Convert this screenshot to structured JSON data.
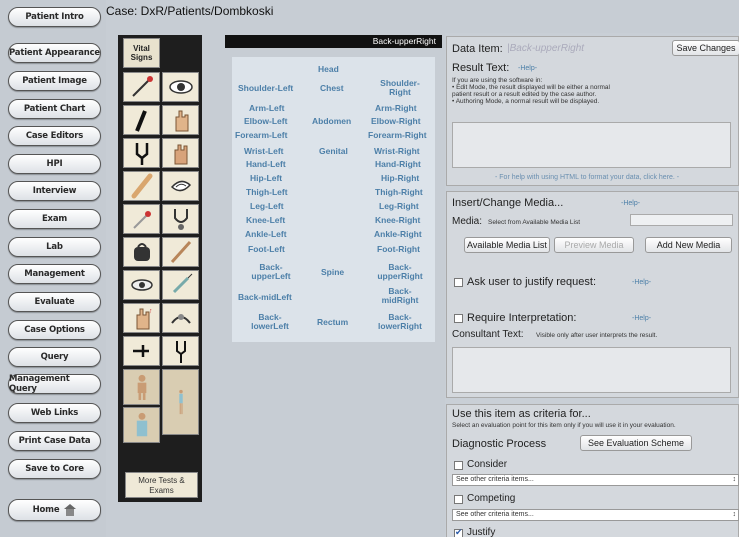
{
  "case_title": "Case: DxR/Patients/Dombkoski",
  "nav": [
    "Patient Intro",
    "Patient Appearance",
    "Patient Image",
    "Patient Chart",
    "Case Editors",
    "HPI",
    "Interview",
    "Exam",
    "Lab",
    "Management",
    "Evaluate",
    "Case Options",
    "Query",
    "Management Query",
    "Web Links",
    "Print Case Data",
    "Save to Core",
    "Home"
  ],
  "palette": {
    "vital_signs": "Vital Signs",
    "more_label": "More Tests & Exams",
    "tools": [
      "reflex-hammer-icon",
      "eye-icon",
      "flashlight-icon",
      "palpate-hand-icon",
      "tuning-fork-icon",
      "hand-icon",
      "otoscope-icon",
      "ear-icon",
      "swab-icon",
      "stethoscope-icon",
      "bp-cuff-icon",
      "tongue-depressor-icon",
      "ophthalmoscope-icon",
      "syringe-icon",
      "hand-up-icon",
      "percussion-icon",
      "thermometer-icon",
      "tuning-fork-2-icon",
      "female-front-icon",
      "female-side-icon",
      "female-torso-icon"
    ]
  },
  "bodymap": {
    "header": "Back-upperRight",
    "parts": {
      "head": "Head",
      "shoulder_left": "Shoulder-Left",
      "chest": "Chest",
      "shoulder_right": "Shoulder-Right",
      "arm_left": "Arm-Left",
      "arm_right": "Arm-Right",
      "elbow_left": "Elbow-Left",
      "abdomen": "Abdomen",
      "elbow_right": "Elbow-Right",
      "forearm_left": "Forearm-Left",
      "forearm_right": "Forearm-Right",
      "wrist_left": "Wrist-Left",
      "genital": "Genital",
      "wrist_right": "Wrist-Right",
      "hand_left": "Hand-Left",
      "hand_right": "Hand-Right",
      "hip_left": "Hip-Left",
      "hip_right": "Hip-Right",
      "thigh_left": "Thigh-Left",
      "thigh_right": "Thigh-Right",
      "leg_left": "Leg-Left",
      "leg_right": "Leg-Right",
      "knee_left": "Knee-Left",
      "knee_right": "Knee-Right",
      "ankle_left": "Ankle-Left",
      "ankle_right": "Ankle-Right",
      "foot_left": "Foot-Left",
      "foot_right": "Foot-Right",
      "back_upper_left": "Back-upperLeft",
      "spine": "Spine",
      "back_upper_right": "Back-upperRight",
      "back_mid_left": "Back-midLeft",
      "back_mid_right": "Back-midRight",
      "back_lower_left": "Back-lowerLeft",
      "rectum": "Rectum",
      "back_lower_right": "Back-lowerRight"
    }
  },
  "data_item": {
    "label": "Data Item:",
    "value": "|Back-upperRight",
    "save_button": "Save Changes",
    "result_text_label": "Result Text:",
    "help": "-Help-",
    "result_note_1": "If you are using the software in:",
    "result_note_2": "• Edit Mode, the result displayed will be either a normal",
    "result_note_3": "patient result or a result edited by the case author.",
    "result_note_4": "• Authoring Mode, a normal result will be displayed.",
    "html_help": "- For help with using HTML to format your data, click here. -"
  },
  "media": {
    "title": "Insert/Change Media...",
    "help": "-Help-",
    "media_label": "Media:",
    "media_hint": "Select from Available Media List",
    "available_button": "Available Media List",
    "preview_button": "Preview Media",
    "add_button": "Add New Media",
    "justify_label": "Ask user to justify request:",
    "justify_help": "-Help-",
    "interp_label": "Require Interpretation:",
    "interp_help": "-Help-",
    "consultant_label": "Consultant Text:",
    "consultant_hint": "Visible only after user interprets the result."
  },
  "criteria": {
    "title": "Use this item as criteria for...",
    "hint": "Select an evaluation point for this item only if you will use it in your evaluation.",
    "diag_label": "Diagnostic Process",
    "eval_button": "See Evaluation Scheme",
    "consider": "Consider",
    "consider_select": "See other criteria items...",
    "competing": "Competing",
    "competing_select": "See other criteria items...",
    "justify": "Justify"
  }
}
